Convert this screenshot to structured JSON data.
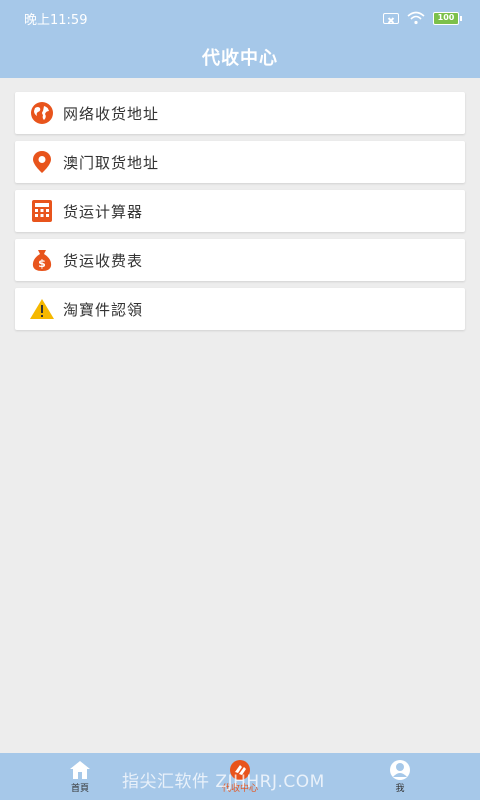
{
  "status_bar": {
    "time": "晚上11:59",
    "battery": "100"
  },
  "header": {
    "title": "代收中心"
  },
  "menu": {
    "items": [
      {
        "label": "网络收货地址",
        "icon": "globe-icon"
      },
      {
        "label": "澳门取货地址",
        "icon": "location-pin-icon"
      },
      {
        "label": "货运计算器",
        "icon": "calculator-icon"
      },
      {
        "label": "货运收费表",
        "icon": "money-bag-icon"
      },
      {
        "label": "淘寶件認領",
        "icon": "warning-icon"
      }
    ]
  },
  "tab_bar": {
    "tabs": [
      {
        "label": "首頁",
        "icon": "home-icon"
      },
      {
        "label": "代收中心",
        "icon": "collection-icon",
        "active": true
      },
      {
        "label": "我",
        "icon": "user-icon"
      }
    ]
  },
  "watermark": "指尖汇软件 ZJHHRJ.COM",
  "colors": {
    "header_bg": "#a6c8e9",
    "accent": "#e8541c",
    "background": "#ededed"
  }
}
